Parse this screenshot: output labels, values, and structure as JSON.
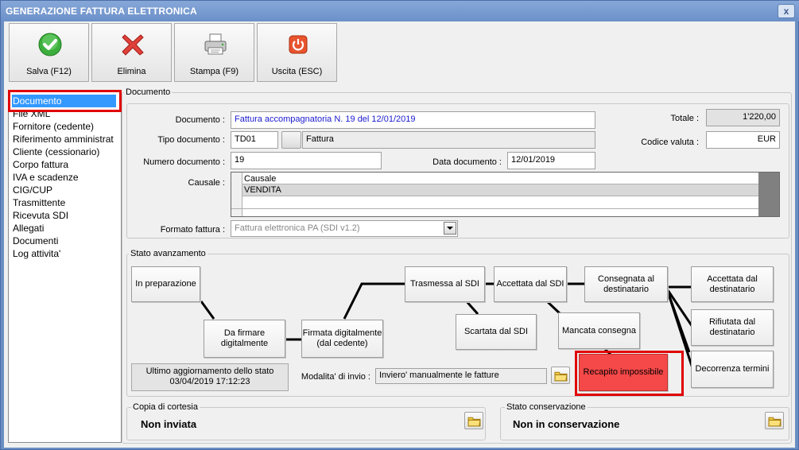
{
  "window": {
    "title": "GENERAZIONE FATTURA ELETTRONICA",
    "close": "x"
  },
  "toolbar": {
    "save": "Salva (F12)",
    "delete": "Elimina",
    "print": "Stampa (F9)",
    "exit": "Uscita (ESC)"
  },
  "nav": {
    "items": [
      "Documento",
      "File XML",
      "Fornitore (cedente)",
      "Riferimento amministrat",
      "Cliente (cessionario)",
      "Corpo fattura",
      "IVA e scadenze",
      "CIG/CUP",
      "Trasmittente",
      "Ricevuta SDI",
      "Allegati",
      "Documenti",
      "Log attivita'"
    ]
  },
  "documento": {
    "group_title": "Documento",
    "documento_label": "Documento :",
    "documento_value": "Fattura accompagnatoria N. 19 del 12/01/2019",
    "tipo_label": "Tipo documento :",
    "tipo_code": "TD01",
    "tipo_desc": "Fattura",
    "numero_label": "Numero documento :",
    "numero_value": "19",
    "data_label": "Data documento :",
    "data_value": "12/01/2019",
    "totale_label": "Totale :",
    "totale_value": "1'220,00",
    "valuta_label": "Codice valuta :",
    "valuta_value": "EUR",
    "causale_label": "Causale :",
    "causale_header": "Causale",
    "causale_row": "VENDITA",
    "formato_label": "Formato fattura :",
    "formato_value": "Fattura elettronica PA (SDI v1.2)"
  },
  "stato": {
    "group_title": "Stato avanzamento",
    "steps": {
      "in_preparazione": "In preparazione",
      "da_firmare": "Da firmare digitalmente",
      "firmata": "Firmata digitalmente (dal cedente)",
      "trasmessa": "Trasmessa al SDI",
      "scartata": "Scartata dal SDI",
      "accettata_sdi": "Accettata dal SDI",
      "mancata": "Mancata consegna",
      "consegnata": "Consegnata al destinatario",
      "recapito": "Recapito impossibile",
      "accettata_dest": "Accettata dal destinatario",
      "rifiutata_dest": "Rifiutata dal destinatario",
      "decorrenza": "Decorrenza termini"
    },
    "ultimo_label": "Ultimo aggiornamento dello stato",
    "ultimo_value": "03/04/2019 17:12:23",
    "modalita_label": "Modalita' di invio :",
    "modalita_value": "Inviero' manualmente le fatture",
    "highlight_color": "#f54848"
  },
  "copia": {
    "group_title": "Copia di cortesia",
    "value": "Non inviata"
  },
  "conservazione": {
    "group_title": "Stato conservazione",
    "value": "Non in conservazione"
  }
}
